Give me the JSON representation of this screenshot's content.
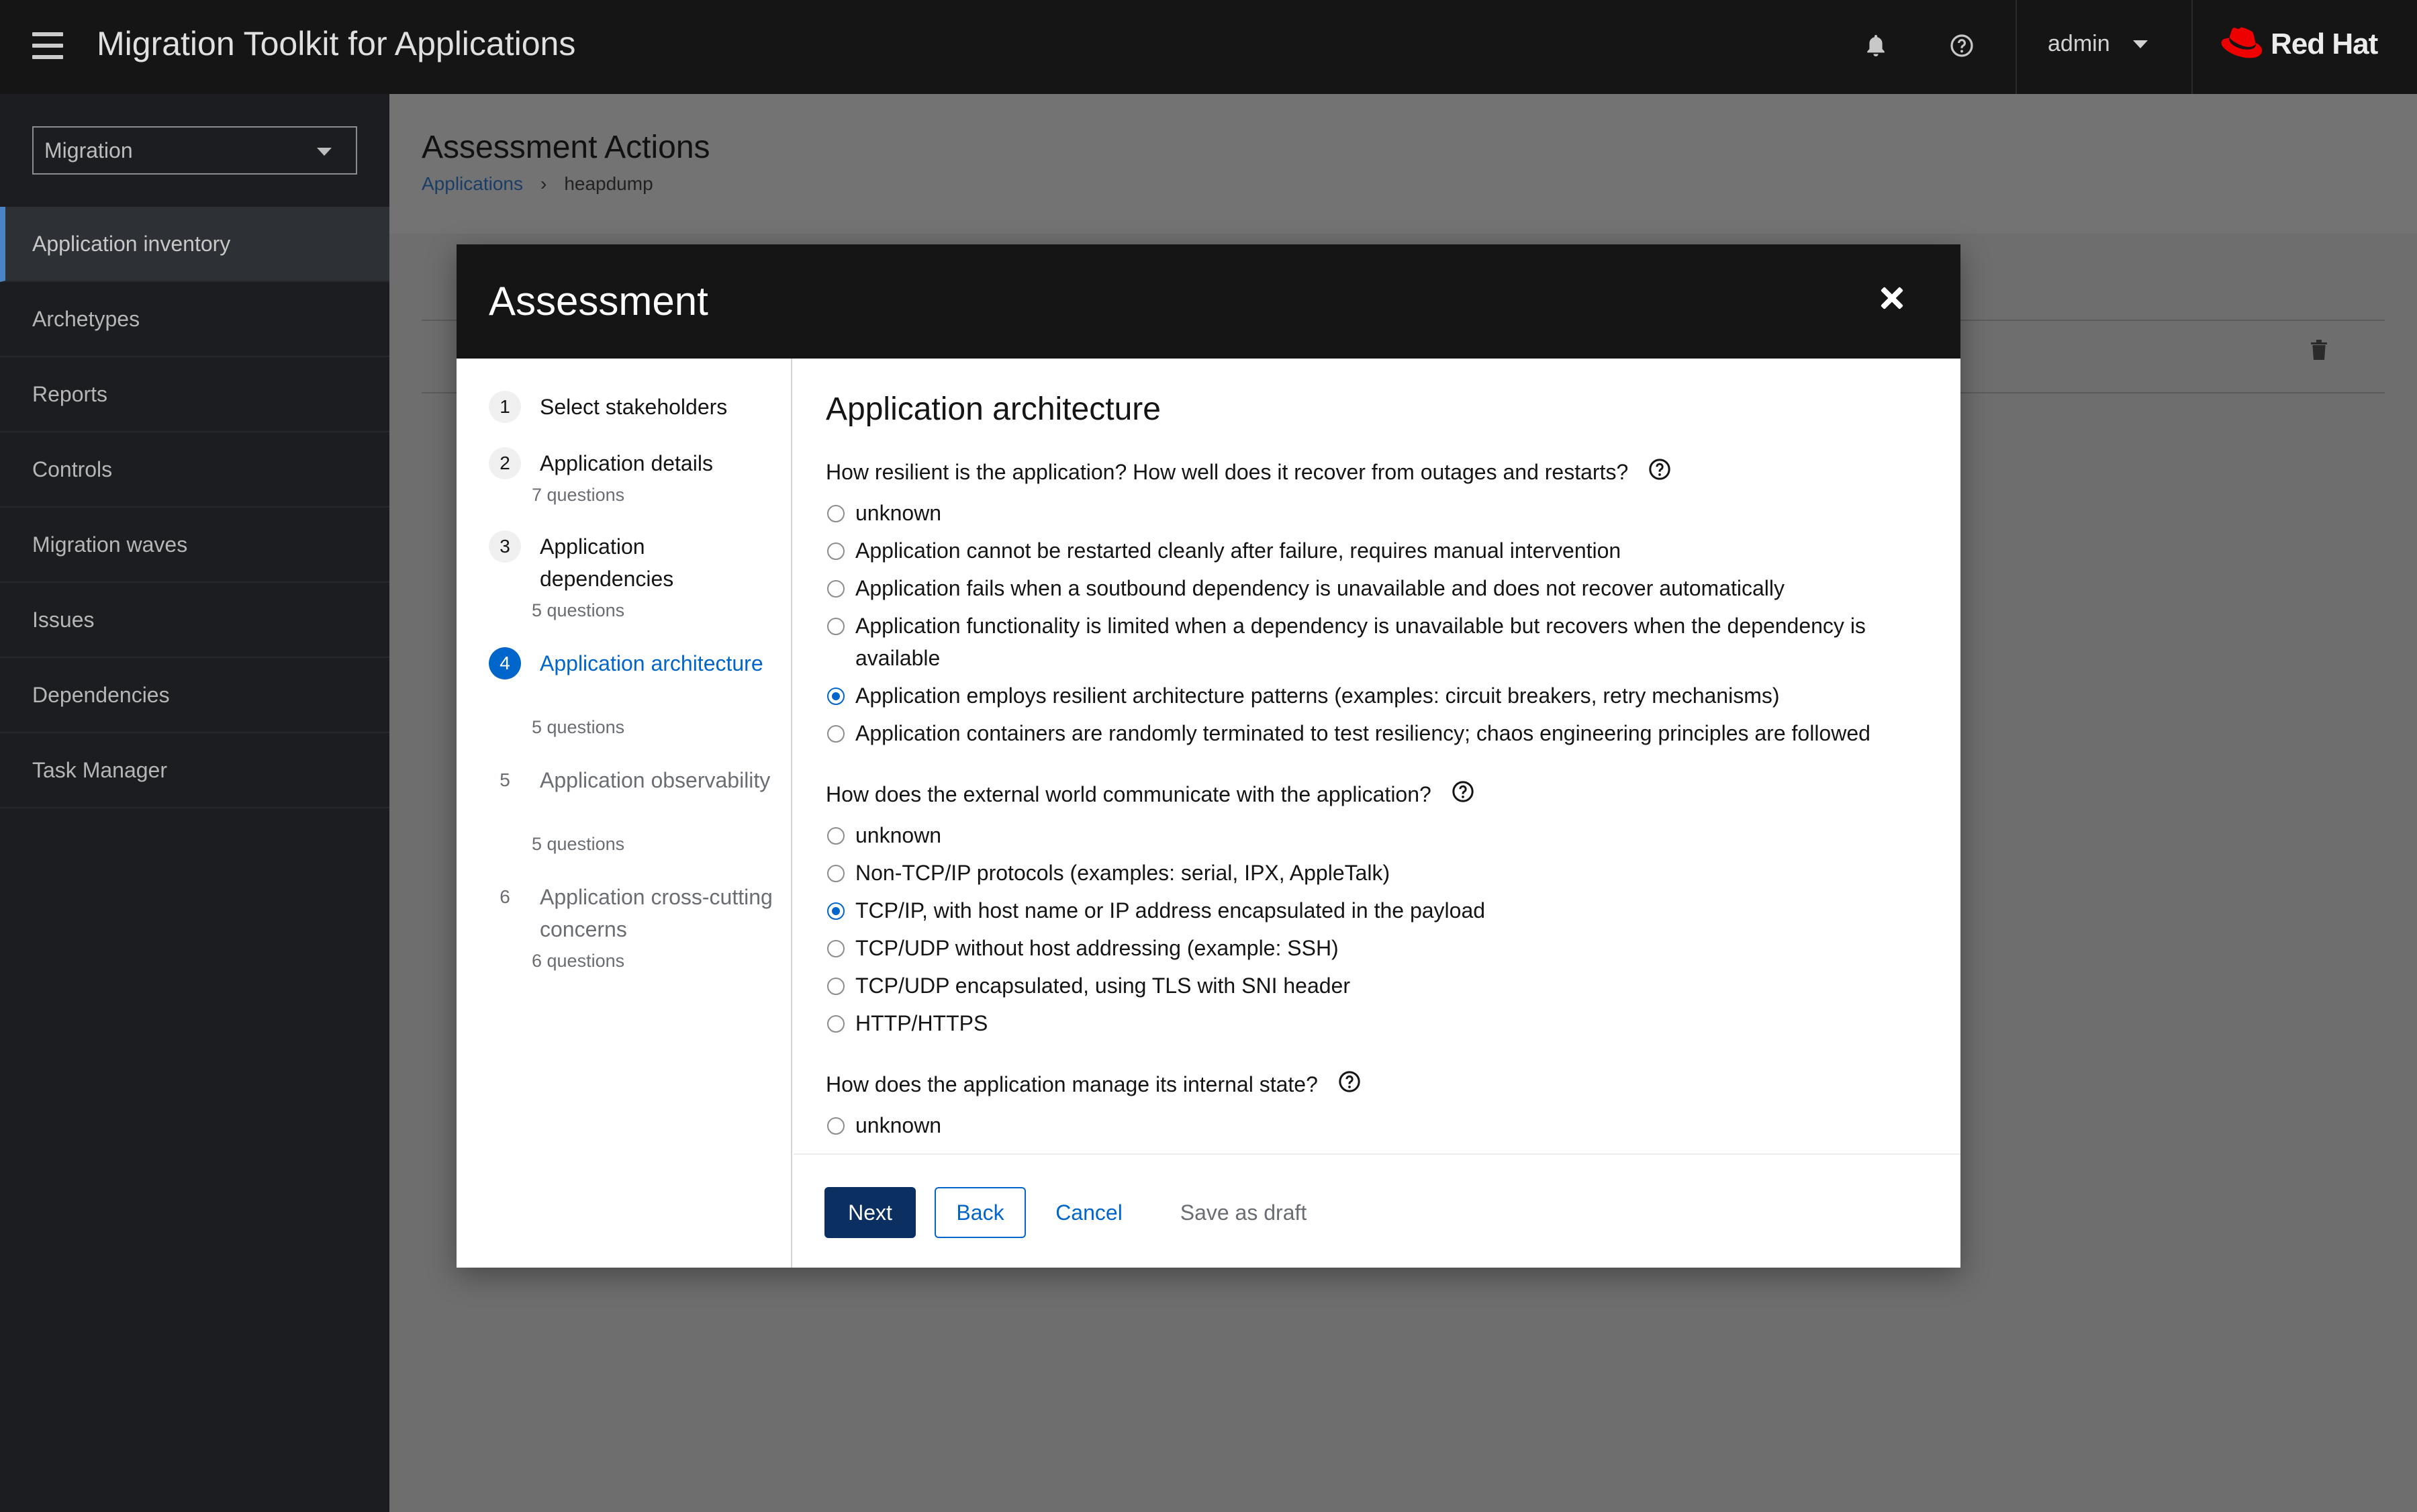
{
  "header": {
    "app_title": "Migration Toolkit for Applications",
    "user": "admin",
    "brand": "Red Hat",
    "icons": [
      "menu-icon",
      "bell-icon",
      "help-icon",
      "caret-down-icon",
      "redhat-hat-icon"
    ]
  },
  "sidebar": {
    "perspective": "Migration",
    "items": [
      {
        "label": "Application inventory",
        "active": true
      },
      {
        "label": "Archetypes",
        "active": false
      },
      {
        "label": "Reports",
        "active": false
      },
      {
        "label": "Controls",
        "active": false
      },
      {
        "label": "Migration waves",
        "active": false
      },
      {
        "label": "Issues",
        "active": false
      },
      {
        "label": "Dependencies",
        "active": false
      },
      {
        "label": "Task Manager",
        "active": false
      }
    ]
  },
  "page": {
    "title": "Assessment Actions",
    "breadcrumb": {
      "link": "Applications",
      "current": "heapdump"
    }
  },
  "modal": {
    "title": "Assessment",
    "steps": [
      {
        "num": "1",
        "label": "Select stakeholders",
        "sub": ""
      },
      {
        "num": "2",
        "label": "Application details",
        "sub": "7 questions"
      },
      {
        "num": "3",
        "label": "Application dependencies",
        "sub": "5 questions"
      },
      {
        "num": "4",
        "label": "Application architecture",
        "sub": "5 questions"
      },
      {
        "num": "5",
        "label": "Application observability",
        "sub": "5 questions"
      },
      {
        "num": "6",
        "label": "Application cross-cutting concerns",
        "sub": "6 questions"
      }
    ],
    "section_title": "Application architecture",
    "questions": [
      {
        "text": "How resilient is the application? How well does it recover from outages and restarts?",
        "options": [
          {
            "label": "unknown",
            "checked": false
          },
          {
            "label": "Application cannot be restarted cleanly after failure, requires manual intervention",
            "checked": false
          },
          {
            "label": "Application fails when a soutbound dependency is unavailable and does not recover automatically",
            "checked": false
          },
          {
            "label": "Application functionality is limited when a dependency is unavailable but recovers when the dependency is available",
            "checked": false
          },
          {
            "label": "Application employs resilient architecture patterns (examples: circuit breakers, retry mechanisms)",
            "checked": true
          },
          {
            "label": "Application containers are randomly terminated to test resiliency; chaos engineering principles are followed",
            "checked": false
          }
        ]
      },
      {
        "text": "How does the external world communicate with the application?",
        "options": [
          {
            "label": "unknown",
            "checked": false
          },
          {
            "label": "Non-TCP/IP protocols (examples: serial, IPX, AppleTalk)",
            "checked": false
          },
          {
            "label": "TCP/IP, with host name or IP address encapsulated in the payload",
            "checked": true
          },
          {
            "label": "TCP/UDP without host addressing (example: SSH)",
            "checked": false
          },
          {
            "label": "TCP/UDP encapsulated, using TLS with SNI header",
            "checked": false
          },
          {
            "label": "HTTP/HTTPS",
            "checked": false
          }
        ]
      },
      {
        "text": "How does the application manage its internal state?",
        "options": [
          {
            "label": "unknown",
            "checked": false
          }
        ]
      }
    ],
    "footer": {
      "next": "Next",
      "back": "Back",
      "cancel": "Cancel",
      "save_draft": "Save as draft"
    }
  }
}
